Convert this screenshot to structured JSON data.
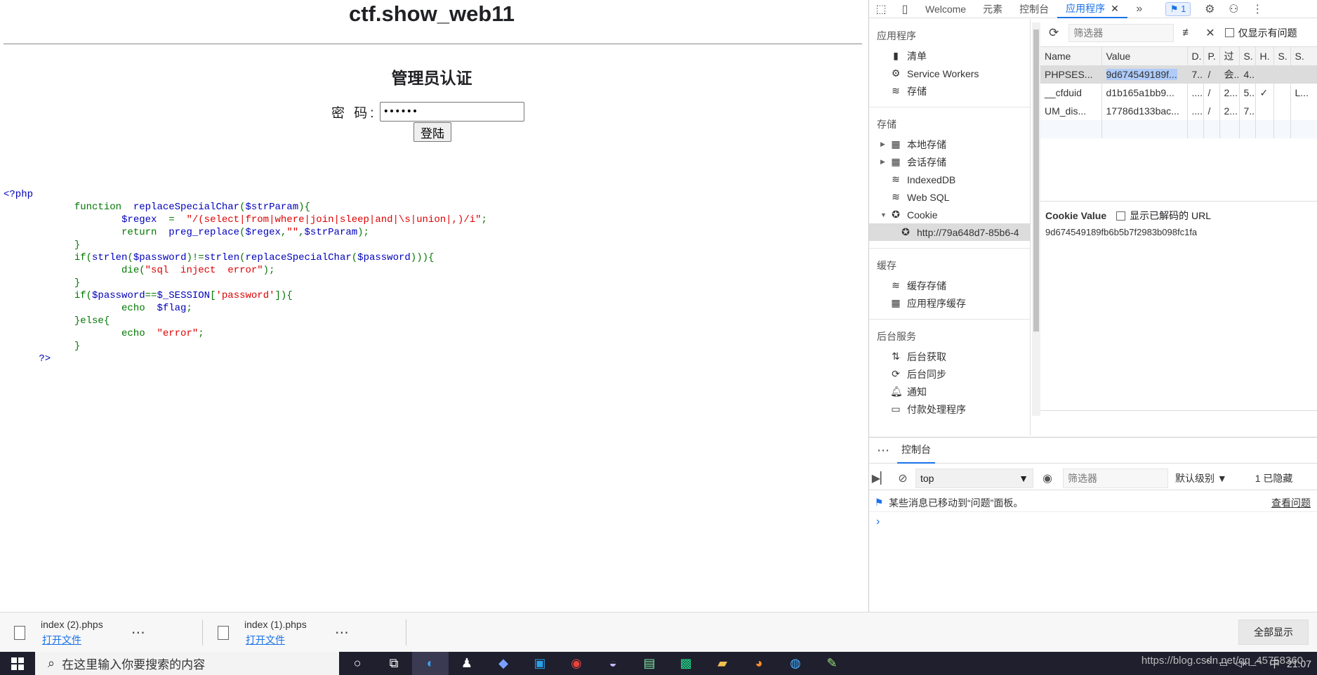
{
  "page": {
    "title": "ctf.show_web11",
    "subtitle": "管理员认证",
    "password_label": "密  码:",
    "password_value": "••••••",
    "login_button": "登陆",
    "code_lines": [
      {
        "parts": [
          {
            "t": "<?php",
            "c": "kw"
          }
        ]
      },
      {
        "parts": [
          {
            "t": "            function  ",
            "c": "g"
          },
          {
            "t": "replaceSpecialChar",
            "c": "fn"
          },
          {
            "t": "(",
            "c": "g"
          },
          {
            "t": "$strParam",
            "c": "kw"
          },
          {
            "t": "){",
            "c": "g"
          }
        ]
      },
      {
        "parts": [
          {
            "t": "                    ",
            "c": "g"
          },
          {
            "t": "$regex  ",
            "c": "kw"
          },
          {
            "t": "=  ",
            "c": "g"
          },
          {
            "t": "\"/(select|from|where|join|sleep|and|\\s|union|,)/i\"",
            "c": "str"
          },
          {
            "t": ";",
            "c": "g"
          }
        ]
      },
      {
        "parts": [
          {
            "t": "                    return  ",
            "c": "g"
          },
          {
            "t": "preg_replace",
            "c": "fn"
          },
          {
            "t": "(",
            "c": "g"
          },
          {
            "t": "$regex",
            "c": "kw"
          },
          {
            "t": ",",
            "c": "g"
          },
          {
            "t": "\"\"",
            "c": "str"
          },
          {
            "t": ",",
            "c": "g"
          },
          {
            "t": "$strParam",
            "c": "kw"
          },
          {
            "t": ");",
            "c": "g"
          }
        ]
      },
      {
        "parts": [
          {
            "t": "            }",
            "c": "g"
          }
        ]
      },
      {
        "parts": [
          {
            "t": "            if(",
            "c": "g"
          },
          {
            "t": "strlen",
            "c": "fn"
          },
          {
            "t": "(",
            "c": "g"
          },
          {
            "t": "$password",
            "c": "kw"
          },
          {
            "t": ")!=",
            "c": "g"
          },
          {
            "t": "strlen",
            "c": "fn"
          },
          {
            "t": "(",
            "c": "g"
          },
          {
            "t": "replaceSpecialChar",
            "c": "fn"
          },
          {
            "t": "(",
            "c": "g"
          },
          {
            "t": "$password",
            "c": "kw"
          },
          {
            "t": "))){",
            "c": "g"
          }
        ]
      },
      {
        "parts": [
          {
            "t": "                    die(",
            "c": "g"
          },
          {
            "t": "\"sql  inject  error\"",
            "c": "str"
          },
          {
            "t": ");",
            "c": "g"
          }
        ]
      },
      {
        "parts": [
          {
            "t": "            }",
            "c": "g"
          }
        ]
      },
      {
        "parts": [
          {
            "t": "            if(",
            "c": "g"
          },
          {
            "t": "$password",
            "c": "kw"
          },
          {
            "t": "==",
            "c": "g"
          },
          {
            "t": "$_SESSION",
            "c": "kw"
          },
          {
            "t": "[",
            "c": "g"
          },
          {
            "t": "'password'",
            "c": "str"
          },
          {
            "t": "]){",
            "c": "g"
          }
        ]
      },
      {
        "parts": [
          {
            "t": "                    echo  ",
            "c": "g"
          },
          {
            "t": "$flag",
            "c": "kw"
          },
          {
            "t": ";",
            "c": "g"
          }
        ]
      },
      {
        "parts": [
          {
            "t": "            }else{",
            "c": "g"
          }
        ]
      },
      {
        "parts": [
          {
            "t": "                    echo  ",
            "c": "g"
          },
          {
            "t": "\"error\"",
            "c": "str"
          },
          {
            "t": ";",
            "c": "g"
          }
        ]
      },
      {
        "parts": [
          {
            "t": "            }",
            "c": "g"
          }
        ]
      },
      {
        "parts": [
          {
            "t": "      ?>",
            "c": "kw"
          }
        ]
      }
    ]
  },
  "devtools": {
    "tabs": [
      "Welcome",
      "元素",
      "控制台",
      "应用程序"
    ],
    "active_tab": "应用程序",
    "issues_count": "1",
    "sidebar": {
      "app_section": "应用程序",
      "app_items": [
        "清单",
        "Service Workers",
        "存储"
      ],
      "storage_section": "存储",
      "storage_items": [
        "本地存储",
        "会话存储",
        "IndexedDB",
        "Web SQL",
        "Cookie"
      ],
      "cookie_child": "http://79a648d7-85b6-4",
      "cache_section": "缓存",
      "cache_items": [
        "缓存存储",
        "应用程序缓存"
      ],
      "bg_section": "后台服务",
      "bg_items": [
        "后台获取",
        "后台同步",
        "通知",
        "付款处理程序"
      ]
    },
    "cookie_toolbar": {
      "filter_placeholder": "筛选器",
      "only_issues_label": "仅显示有问题"
    },
    "cookie_table": {
      "headers": [
        "Name",
        "Value",
        "D.",
        "P.",
        "过",
        "S.",
        "H.",
        "S.",
        "S."
      ],
      "rows": [
        [
          "PHPSES...",
          "9d674549189f...",
          "7...",
          "/",
          "会...",
          "4...",
          "",
          "",
          ""
        ],
        [
          "__cfduid",
          "d1b165a1bb9...",
          "....",
          "/",
          "2...",
          "5...",
          "✓",
          "",
          "L..."
        ],
        [
          "UM_dis...",
          "17786d133bac...",
          "....",
          "/",
          "2...",
          "7...",
          "",
          "",
          ""
        ]
      ]
    },
    "cookie_value": {
      "label": "Cookie Value",
      "decode_label": "显示已解码的 URL",
      "value": "9d674549189fb6b5b7f2983b098fc1fa"
    },
    "console": {
      "tab": "控制台",
      "context": "top",
      "filter_placeholder": "筛选器",
      "level": "默认级别 ▼",
      "hidden": "1 已隐藏",
      "message": "某些消息已移动到“问题”面板。",
      "message_link": "查看问题"
    }
  },
  "downloads": {
    "items": [
      {
        "name": "index (2).phps",
        "action": "打开文件"
      },
      {
        "name": "index (1).phps",
        "action": "打开文件"
      }
    ],
    "show_all": "全部显示"
  },
  "taskbar": {
    "search_placeholder": "在这里输入你要搜索的内容",
    "time": "21:07",
    "ime": "中",
    "watermark": "https://blog.csdn.net/qq_45758360"
  }
}
